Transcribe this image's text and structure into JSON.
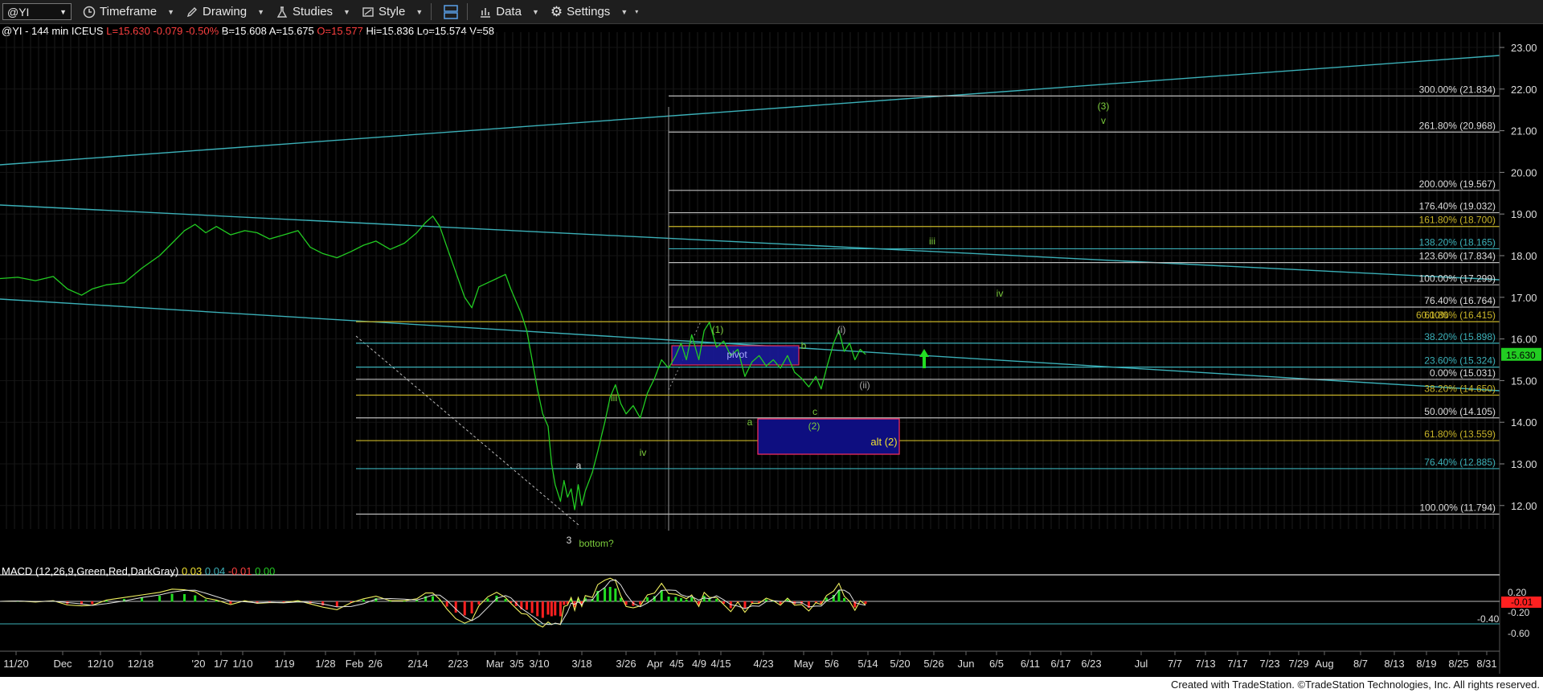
{
  "toolbar": {
    "symbol": "@YI",
    "timeframe_label": "Timeframe",
    "drawing_label": "Drawing",
    "studies_label": "Studies",
    "style_label": "Style",
    "data_label": "Data",
    "settings_label": "Settings"
  },
  "info": {
    "symbol_line": "@YI - 144 min ICEUS",
    "last": "L=15.630",
    "change": "-0.079",
    "change_pct": "-0.50%",
    "bid": "B=15.608",
    "ask": "A=15.675",
    "open": "O=15.577",
    "high": "Hi=15.836",
    "low": "Lo=15.574",
    "volume": "V=58"
  },
  "colors": {
    "background": "#000000",
    "price_line": "#22cc22",
    "fib_line": "#c8c8c8",
    "trend_line": "#3bb0b8",
    "label_green": "#7ccd3c",
    "box_blue": "#10108a",
    "last_price": "#22cc22",
    "macd_negative": "#ff2020",
    "macd_positive": "#22dd22"
  },
  "chart_data": {
    "type": "line",
    "y_range": [
      11.5,
      23.2
    ],
    "y_ticks": [
      "23.000",
      "22.000",
      "21.000",
      "20.000",
      "19.000",
      "18.000",
      "17.000",
      "16.000",
      "15.000",
      "14.000",
      "13.000",
      "12.000"
    ],
    "x_labels": [
      "11/20",
      "Dec",
      "12/10",
      "12/18",
      "'20",
      "1/7",
      "1/10",
      "1/19",
      "1/28",
      "Feb",
      "2/6",
      "2/14",
      "2/23",
      "Mar",
      "3/5",
      "3/10",
      "3/18",
      "3/26",
      "Apr",
      "4/5",
      "4/9",
      "4/15",
      "4/23",
      "May",
      "5/6",
      "5/14",
      "5/20",
      "5/26",
      "Jun",
      "6/5",
      "6/11",
      "6/17",
      "6/23",
      "Jul",
      "7/7",
      "7/13",
      "7/17",
      "7/23",
      "7/29",
      "Aug",
      "8/7",
      "8/13",
      "8/19",
      "8/25",
      "8/31"
    ],
    "last_price": "15.630",
    "price_series": [
      [
        0,
        17.45
      ],
      [
        10,
        17.48
      ],
      [
        20,
        17.4
      ],
      [
        30,
        17.5
      ],
      [
        38,
        17.2
      ],
      [
        46,
        17.05
      ],
      [
        52,
        17.2
      ],
      [
        60,
        17.3
      ],
      [
        70,
        17.35
      ],
      [
        80,
        17.7
      ],
      [
        90,
        18.0
      ],
      [
        97,
        18.3
      ],
      [
        104,
        18.6
      ],
      [
        110,
        18.75
      ],
      [
        116,
        18.55
      ],
      [
        122,
        18.7
      ],
      [
        130,
        18.5
      ],
      [
        138,
        18.6
      ],
      [
        145,
        18.55
      ],
      [
        152,
        18.4
      ],
      [
        160,
        18.5
      ],
      [
        168,
        18.6
      ],
      [
        175,
        18.2
      ],
      [
        182,
        18.05
      ],
      [
        190,
        17.95
      ],
      [
        198,
        18.1
      ],
      [
        205,
        18.25
      ],
      [
        212,
        18.35
      ],
      [
        220,
        18.15
      ],
      [
        228,
        18.3
      ],
      [
        235,
        18.55
      ],
      [
        240,
        18.8
      ],
      [
        244,
        18.95
      ],
      [
        248,
        18.7
      ],
      [
        252,
        18.2
      ],
      [
        257,
        17.6
      ],
      [
        262,
        17.0
      ],
      [
        266,
        16.75
      ],
      [
        270,
        17.25
      ],
      [
        275,
        17.35
      ],
      [
        280,
        17.45
      ],
      [
        285,
        17.55
      ],
      [
        288,
        17.2
      ],
      [
        291,
        16.9
      ],
      [
        294,
        16.6
      ],
      [
        297,
        16.2
      ],
      [
        300,
        15.5
      ],
      [
        303,
        14.8
      ],
      [
        306,
        14.2
      ],
      [
        309,
        13.9
      ],
      [
        311,
        13.0
      ],
      [
        313,
        12.5
      ],
      [
        316,
        12.1
      ],
      [
        318,
        12.6
      ],
      [
        320,
        12.2
      ],
      [
        322,
        12.4
      ],
      [
        324,
        11.9
      ],
      [
        326,
        12.5
      ],
      [
        328,
        12.0
      ],
      [
        330,
        12.35
      ],
      [
        334,
        12.8
      ],
      [
        337,
        13.3
      ],
      [
        341,
        14.0
      ],
      [
        344,
        14.6
      ],
      [
        347,
        14.9
      ],
      [
        350,
        14.45
      ],
      [
        353,
        14.2
      ],
      [
        357,
        14.4
      ],
      [
        361,
        14.1
      ],
      [
        365,
        14.7
      ],
      [
        369,
        15.05
      ],
      [
        373,
        15.5
      ],
      [
        377,
        15.3
      ],
      [
        381,
        15.6
      ],
      [
        384,
        15.9
      ],
      [
        387,
        15.5
      ],
      [
        390,
        16.1
      ],
      [
        394,
        15.5
      ],
      [
        397,
        16.2
      ],
      [
        400,
        16.4
      ],
      [
        404,
        15.8
      ],
      [
        408,
        15.95
      ],
      [
        412,
        15.6
      ],
      [
        416,
        15.75
      ],
      [
        420,
        15.1
      ],
      [
        424,
        15.45
      ],
      [
        428,
        15.6
      ],
      [
        432,
        15.35
      ],
      [
        436,
        15.5
      ],
      [
        440,
        15.3
      ],
      [
        444,
        15.6
      ],
      [
        448,
        15.2
      ],
      [
        452,
        15.05
      ],
      [
        456,
        14.85
      ],
      [
        460,
        15.1
      ],
      [
        463,
        14.8
      ],
      [
        466,
        15.3
      ],
      [
        470,
        15.9
      ],
      [
        473,
        16.2
      ],
      [
        476,
        15.7
      ],
      [
        479,
        15.9
      ],
      [
        482,
        15.5
      ],
      [
        485,
        15.75
      ],
      [
        488,
        15.63
      ]
    ],
    "fib_levels": [
      {
        "pct": "300.00%",
        "value": "21.834"
      },
      {
        "pct": "261.80%",
        "value": "20.968"
      },
      {
        "pct": "200.00%",
        "value": "19.567"
      },
      {
        "pct": "176.40%",
        "value": "19.032"
      },
      {
        "pct": "161.80%",
        "value": "18.700"
      },
      {
        "pct": "138.20%",
        "value": "18.165"
      },
      {
        "pct": "123.60%",
        "value": "17.834"
      },
      {
        "pct": "100.00%",
        "value": "17.299"
      },
      {
        "pct": "76.40%",
        "value": "16.764"
      },
      {
        "pct": "61.80%",
        "value": "16.415"
      },
      {
        "pct": "38.20%",
        "value": "15.898"
      },
      {
        "pct": "23.60%",
        "value": "15.324"
      },
      {
        "pct": "0.00%",
        "value": "15.031"
      },
      {
        "pct": "38.20%",
        "value": "14.650"
      },
      {
        "pct": "50.00%",
        "value": "14.105"
      },
      {
        "pct": "61.80%",
        "value": "13.559"
      },
      {
        "pct": "76.40%",
        "value": "12.885"
      },
      {
        "pct": "100.00%",
        "value": "11.794"
      }
    ],
    "fib_overlap_text": "60.00%",
    "wave_labels": [
      "(3)",
      "v",
      "iii",
      "iv",
      "(1)",
      "pivot",
      "b",
      "(i)",
      "(ii)",
      "c",
      "a",
      "(2)",
      "alt (2)",
      "iii",
      "iv",
      "a",
      "3",
      "bottom?"
    ],
    "macd": {
      "label": "MACD (12,26,9,Green,Red,DarkGray)",
      "values": [
        "0.03",
        "0.04",
        "-0.01",
        "0.00"
      ],
      "y_ticks": [
        "0.20",
        "-0.20",
        "-0.40",
        "-0.60"
      ],
      "last_value": "-0.01"
    }
  },
  "footer": {
    "credit": "Created with TradeStation. ©TradeStation Technologies, Inc. All rights reserved."
  }
}
